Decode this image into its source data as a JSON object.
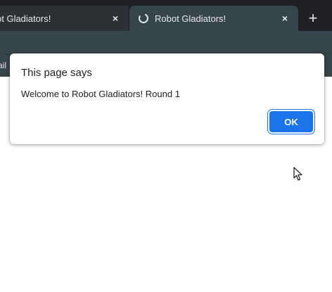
{
  "tabs": [
    {
      "title": "ot Gladiators!",
      "active": false,
      "close_icon": "×"
    },
    {
      "title": "Robot Gladiators!",
      "active": true,
      "loading": true,
      "close_icon": "×"
    }
  ],
  "new_tab_icon": "+",
  "bookmarks_bar": {
    "partial_item": "ail"
  },
  "dialog": {
    "title": "This page says",
    "message": "Welcome to Robot Gladiators! Round 1",
    "ok_label": "OK"
  },
  "colors": {
    "tabstrip": "#202124",
    "active_tab": "#36454a",
    "accent": "#1a73e8"
  }
}
